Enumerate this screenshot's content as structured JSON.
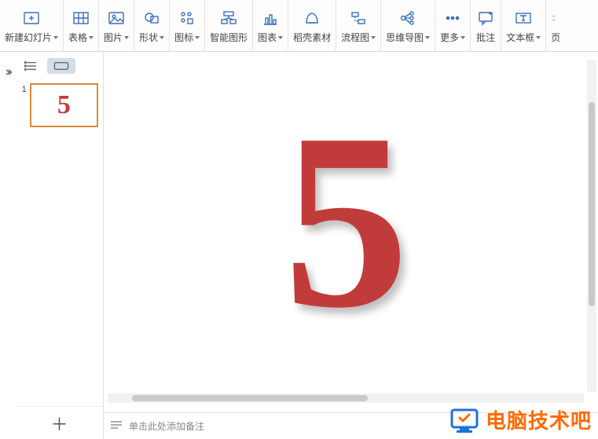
{
  "ribbon": {
    "new_slide": "新建幻灯片",
    "table": "表格",
    "picture": "图片",
    "shape": "形状",
    "icon": "图标",
    "smartart": "智能图形",
    "chart": "图表",
    "docer": "稻壳素材",
    "flow": "流程图",
    "mindmap": "思维导图",
    "more": "更多",
    "comment": "批注",
    "textbox": "文本框",
    "page_partial": "页"
  },
  "slides": {
    "current_index": "1",
    "thumb_content": "5"
  },
  "canvas": {
    "main_number": "5"
  },
  "notes": {
    "placeholder": "单击此处添加备注"
  },
  "watermark": {
    "text": "电脑技术吧"
  }
}
